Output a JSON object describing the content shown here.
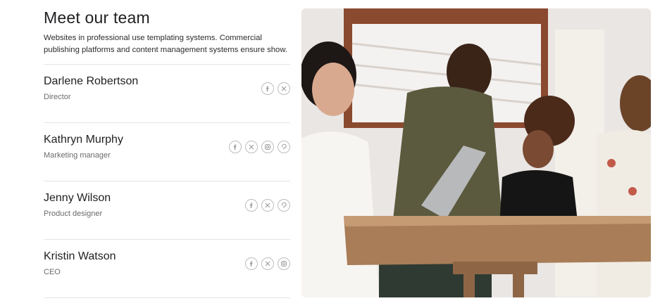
{
  "section": {
    "title": "Meet our team",
    "intro": "Websites in professional use templating systems. Commercial publishing platforms and content management systems ensure show."
  },
  "members": [
    {
      "name": "Darlene Robertson",
      "role": "Director",
      "socials": [
        "facebook-icon",
        "x-icon"
      ]
    },
    {
      "name": "Kathryn Murphy",
      "role": "Marketing manager",
      "socials": [
        "facebook-icon",
        "x-icon",
        "instagram-icon",
        "pinterest-icon"
      ]
    },
    {
      "name": "Jenny Wilson",
      "role": "Product designer",
      "socials": [
        "facebook-icon",
        "x-icon",
        "pinterest-icon"
      ]
    },
    {
      "name": "Kristin Watson",
      "role": "CEO",
      "socials": [
        "facebook-icon",
        "x-icon",
        "instagram-icon"
      ]
    }
  ],
  "colors": {
    "text": "#1f1f22",
    "muted": "#6b6b6b",
    "icon": "#9a9a9a",
    "divider": "#e4e4e4"
  }
}
